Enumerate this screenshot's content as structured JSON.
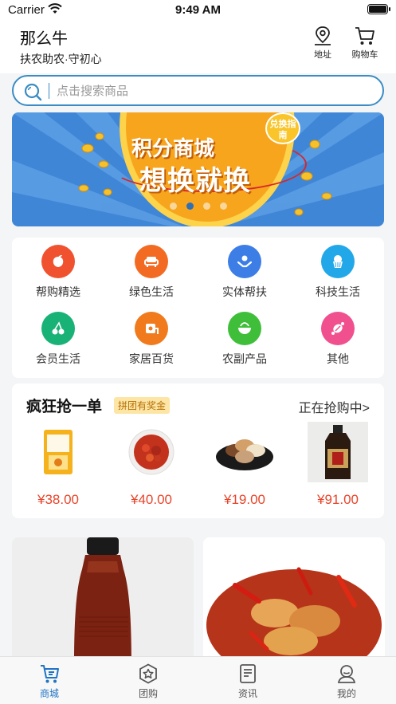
{
  "status_bar": {
    "carrier": "Carrier",
    "time": "9:49 AM"
  },
  "header": {
    "title": "那么牛",
    "slogan": "扶农助农·守初心",
    "address_label": "地址",
    "cart_label": "购物车"
  },
  "search": {
    "placeholder": "点击搜索商品"
  },
  "banner": {
    "line1": "积分商城",
    "line2": "想换就换",
    "badge": "兑换指南",
    "slides": 4,
    "active_slide": 2
  },
  "categories": [
    {
      "label": "帮购精选",
      "icon": "peach-icon",
      "color": "#f0522f"
    },
    {
      "label": "绿色生活",
      "icon": "sofa-icon",
      "color": "#f36b22"
    },
    {
      "label": "实体帮扶",
      "icon": "hands-icon",
      "color": "#3c7ee6"
    },
    {
      "label": "科技生活",
      "icon": "cake-icon",
      "color": "#22a8e8"
    },
    {
      "label": "会员生活",
      "icon": "cherry-icon",
      "color": "#19b276"
    },
    {
      "label": "家居百货",
      "icon": "tissue-icon",
      "color": "#f07a1c"
    },
    {
      "label": "农副产品",
      "icon": "bowl-icon",
      "color": "#3fbe3a"
    },
    {
      "label": "其他",
      "icon": "candy-icon",
      "color": "#f0508e"
    }
  ],
  "flash_sale": {
    "title": "疯狂抢一单",
    "tag": "拼团有奖金",
    "more": "正在抢购中>",
    "products": [
      {
        "price": "¥38.00",
        "image": "snack-bag"
      },
      {
        "price": "¥40.00",
        "image": "crayfish-plate"
      },
      {
        "price": "¥19.00",
        "image": "cookies-plate"
      },
      {
        "price": "¥91.00",
        "image": "sauce-bottle"
      }
    ]
  },
  "tabbar": [
    {
      "label": "商城",
      "icon": "cart-home-icon",
      "active": true
    },
    {
      "label": "团购",
      "icon": "star-badge-icon",
      "active": false
    },
    {
      "label": "资讯",
      "icon": "news-icon",
      "active": false
    },
    {
      "label": "我的",
      "icon": "user-icon",
      "active": false
    }
  ],
  "colors": {
    "accent": "#1f74c4",
    "price": "#e8452b",
    "search_border": "#3a8cc4"
  }
}
